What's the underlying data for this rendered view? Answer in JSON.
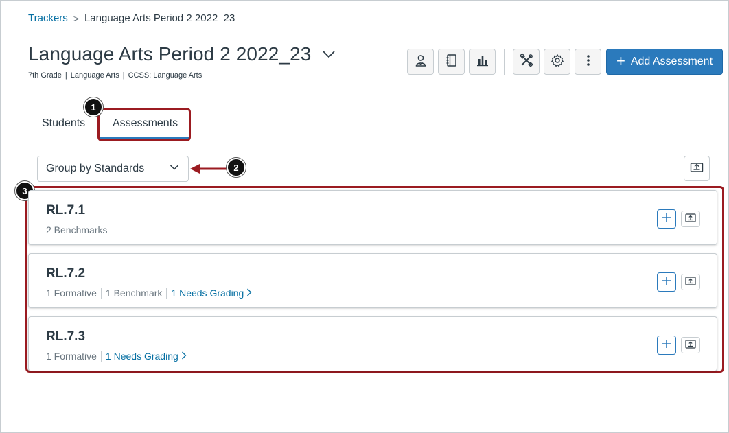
{
  "breadcrumb": {
    "root": "Trackers",
    "separator": ">",
    "current": "Language Arts Period 2 2022_23"
  },
  "header": {
    "title": "Language Arts Period 2 2022_23",
    "subtitle": {
      "grade": "7th Grade",
      "subject": "Language Arts",
      "standards": "CCSS: Language Arts",
      "divider": "|"
    }
  },
  "toolbar": {
    "icons": [
      "student-view-icon",
      "notebook-icon",
      "bar-chart-icon",
      "tools-icon",
      "gear-icon",
      "more-vertical-icon"
    ],
    "add_label": "Add Assessment",
    "add_plus": "+"
  },
  "tabs": [
    {
      "label": "Students",
      "selected": false
    },
    {
      "label": "Assessments",
      "selected": true
    }
  ],
  "group_select": {
    "value": "Group by Standards"
  },
  "standards": [
    {
      "code": "RL.7.1",
      "meta": [
        "2 Benchmarks"
      ],
      "needs_grading": ""
    },
    {
      "code": "RL.7.2",
      "meta": [
        "1 Formative",
        "1 Benchmark"
      ],
      "needs_grading": "1 Needs Grading"
    },
    {
      "code": "RL.7.3",
      "meta": [
        "1 Formative"
      ],
      "needs_grading": "1 Needs Grading"
    }
  ],
  "callouts": [
    "1",
    "2",
    "3"
  ],
  "colors": {
    "accent": "#2b7abc",
    "link": "#0770a3",
    "highlight": "#9b1b21",
    "text": "#2d3b45"
  }
}
